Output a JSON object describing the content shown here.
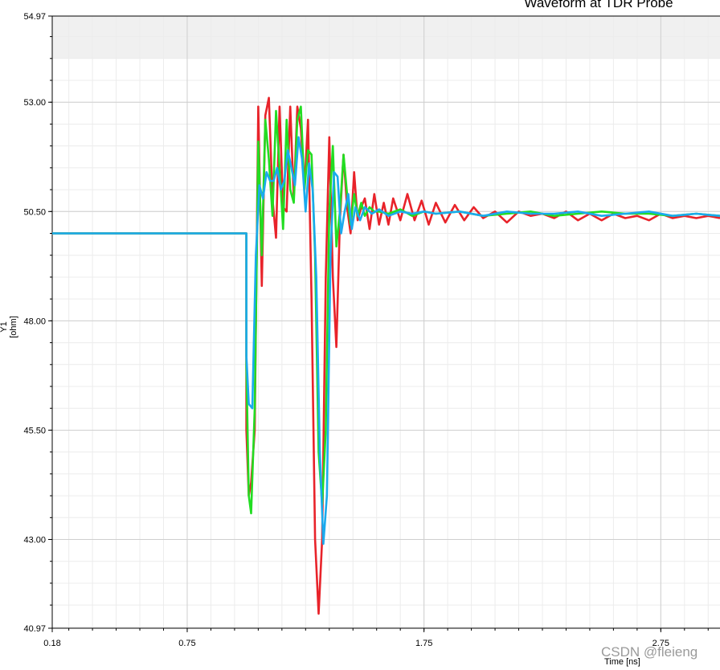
{
  "chart_data": {
    "type": "line",
    "title": "Waveform at TDR Probe",
    "xlabel": "Time [ns]",
    "ylabel": "Y1 [ohm]",
    "xlim": [
      0.18,
      3.0
    ],
    "ylim": [
      40.97,
      54.97
    ],
    "x_ticks": [
      "0.18",
      "0.75",
      "1.75",
      "2.75"
    ],
    "y_ticks": [
      "40.97",
      "43.00",
      "45.50",
      "48.00",
      "50.50",
      "53.00",
      "54.97"
    ],
    "grid": true,
    "series": [
      {
        "color": "#e8232a",
        "x": [
          0.18,
          1.0,
          1.0,
          1.01,
          1.02,
          1.035,
          1.05,
          1.065,
          1.08,
          1.095,
          1.11,
          1.125,
          1.14,
          1.155,
          1.17,
          1.185,
          1.2,
          1.215,
          1.23,
          1.245,
          1.26,
          1.275,
          1.29,
          1.305,
          1.32,
          1.335,
          1.35,
          1.365,
          1.38,
          1.395,
          1.41,
          1.425,
          1.44,
          1.455,
          1.47,
          1.485,
          1.5,
          1.52,
          1.54,
          1.56,
          1.58,
          1.6,
          1.62,
          1.65,
          1.68,
          1.71,
          1.74,
          1.77,
          1.8,
          1.84,
          1.88,
          1.92,
          1.96,
          2.0,
          2.05,
          2.1,
          2.15,
          2.2,
          2.25,
          2.3,
          2.35,
          2.4,
          2.45,
          2.5,
          2.55,
          2.6,
          2.65,
          2.7,
          2.75,
          2.8,
          2.85,
          2.9,
          2.95,
          3.0
        ],
        "y": [
          50.0,
          50.0,
          45.5,
          44.0,
          44.3,
          45.5,
          52.9,
          48.8,
          52.7,
          53.1,
          50.8,
          49.9,
          52.9,
          50.6,
          50.5,
          52.9,
          50.8,
          52.9,
          52.4,
          51.0,
          52.6,
          48.5,
          43.0,
          41.3,
          43.0,
          49.0,
          52.2,
          49.0,
          47.4,
          50.3,
          51.8,
          50.6,
          50.0,
          51.4,
          50.3,
          50.6,
          50.8,
          50.1,
          50.9,
          50.2,
          50.7,
          50.2,
          50.8,
          50.3,
          50.9,
          50.3,
          50.75,
          50.2,
          50.7,
          50.25,
          50.65,
          50.3,
          50.6,
          50.35,
          50.5,
          50.25,
          50.5,
          50.4,
          50.45,
          50.35,
          50.5,
          50.3,
          50.45,
          50.3,
          50.45,
          50.35,
          50.4,
          50.3,
          50.45,
          50.35,
          50.4,
          50.35,
          50.4,
          50.35
        ]
      },
      {
        "color": "#22dd22",
        "x": [
          0.18,
          1.0,
          1.0,
          1.01,
          1.02,
          1.035,
          1.05,
          1.065,
          1.08,
          1.095,
          1.11,
          1.125,
          1.14,
          1.155,
          1.17,
          1.185,
          1.2,
          1.215,
          1.23,
          1.245,
          1.26,
          1.275,
          1.29,
          1.305,
          1.32,
          1.335,
          1.35,
          1.365,
          1.38,
          1.395,
          1.41,
          1.425,
          1.44,
          1.455,
          1.47,
          1.485,
          1.5,
          1.52,
          1.54,
          1.56,
          1.6,
          1.65,
          1.7,
          1.75,
          1.8,
          1.9,
          2.0,
          2.1,
          2.2,
          2.3,
          2.4,
          2.5,
          2.6,
          2.7,
          2.8,
          2.9,
          3.0
        ],
        "y": [
          50.0,
          50.0,
          47.0,
          44.0,
          43.6,
          46.0,
          52.1,
          49.5,
          52.6,
          51.7,
          50.4,
          52.8,
          51.5,
          50.1,
          52.6,
          51.0,
          50.7,
          52.6,
          52.9,
          51.0,
          51.9,
          51.8,
          49.5,
          45.0,
          43.8,
          45.5,
          50.5,
          52.0,
          49.7,
          50.5,
          51.8,
          50.9,
          50.2,
          50.9,
          50.4,
          50.7,
          50.4,
          50.6,
          50.5,
          50.5,
          50.45,
          50.55,
          50.4,
          50.5,
          50.45,
          50.5,
          50.4,
          50.45,
          50.5,
          50.4,
          50.45,
          50.5,
          50.45,
          50.45,
          50.4,
          50.45,
          50.4
        ]
      },
      {
        "color": "#1aaaee",
        "x": [
          0.18,
          1.0,
          1.0,
          1.01,
          1.025,
          1.04,
          1.055,
          1.07,
          1.085,
          1.1,
          1.115,
          1.13,
          1.145,
          1.16,
          1.175,
          1.19,
          1.205,
          1.22,
          1.235,
          1.25,
          1.265,
          1.28,
          1.295,
          1.31,
          1.325,
          1.34,
          1.355,
          1.37,
          1.385,
          1.4,
          1.415,
          1.43,
          1.445,
          1.46,
          1.48,
          1.5,
          1.53,
          1.56,
          1.6,
          1.65,
          1.7,
          1.75,
          1.8,
          1.9,
          2.0,
          2.1,
          2.2,
          2.3,
          2.4,
          2.5,
          2.6,
          2.7,
          2.8,
          2.9,
          3.0
        ],
        "y": [
          50.0,
          50.0,
          47.2,
          46.1,
          46.0,
          49.5,
          51.1,
          50.8,
          51.4,
          51.2,
          51.2,
          51.5,
          51.0,
          51.2,
          51.9,
          51.5,
          51.1,
          52.2,
          51.7,
          50.5,
          51.6,
          51.0,
          49.0,
          45.0,
          42.9,
          44.0,
          49.5,
          51.4,
          51.3,
          50.0,
          50.5,
          50.9,
          50.1,
          50.6,
          50.3,
          50.6,
          50.45,
          50.55,
          50.4,
          50.5,
          50.45,
          50.5,
          50.45,
          50.5,
          50.4,
          50.5,
          50.45,
          50.45,
          50.5,
          50.4,
          50.45,
          50.5,
          50.4,
          50.45,
          50.4
        ]
      }
    ]
  },
  "watermark": "CSDN @fleieng"
}
